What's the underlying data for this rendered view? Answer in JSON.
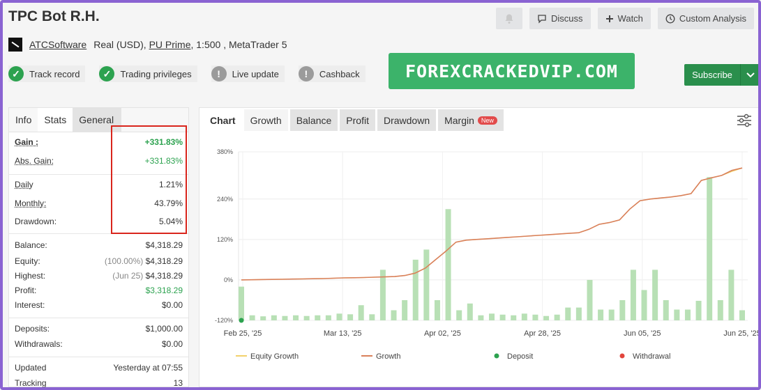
{
  "header": {
    "title": "TPC Bot R.H.",
    "buttons": {
      "discuss": "Discuss",
      "watch": "Watch",
      "custom_analysis": "Custom Analysis"
    }
  },
  "account": {
    "owner": "ATCSoftware",
    "type": "Real (USD),",
    "broker": "PU Prime",
    "leverage_platform": ", 1:500 , MetaTrader 5"
  },
  "badges": [
    {
      "label": "Track record",
      "status": "ok"
    },
    {
      "label": "Trading privileges",
      "status": "ok"
    },
    {
      "label": "Live update",
      "status": "warn"
    },
    {
      "label": "Cashback",
      "status": "warn"
    }
  ],
  "promo": "FOREXCRACKEDVIP.COM",
  "subscribe": "Subscribe",
  "left_tabs": [
    "Info",
    "Stats",
    "General"
  ],
  "stats": {
    "gain": {
      "k": "Gain :",
      "v": "+331.83%"
    },
    "abs_gain": {
      "k": "Abs. Gain:",
      "v": "+331.83%"
    },
    "daily": {
      "k": "Daily",
      "v": "1.21%"
    },
    "monthly": {
      "k": "Monthly:",
      "v": "43.79%"
    },
    "drawdown": {
      "k": "Drawdown:",
      "v": "5.04%"
    },
    "balance": {
      "k": "Balance:",
      "v": "$4,318.29"
    },
    "equity": {
      "k": "Equity:",
      "pre": "(100.00%)",
      "v": "$4,318.29"
    },
    "highest": {
      "k": "Highest:",
      "pre": "(Jun 25)",
      "v": "$4,318.29"
    },
    "profit": {
      "k": "Profit:",
      "v": "$3,318.29"
    },
    "interest": {
      "k": "Interest:",
      "v": "$0.00"
    },
    "deposits": {
      "k": "Deposits:",
      "v": "$1,000.00"
    },
    "withdrawals": {
      "k": "Withdrawals:",
      "v": "$0.00"
    },
    "updated": {
      "k": "Updated",
      "v": "Yesterday at 07:55"
    },
    "tracking": {
      "k": "Tracking",
      "v": "13"
    }
  },
  "right_tabs": {
    "chart": "Chart",
    "growth": "Growth",
    "balance": "Balance",
    "profit": "Profit",
    "drawdown": "Drawdown",
    "margin": "Margin",
    "new": "New"
  },
  "colors": {
    "green": "#2ca24f",
    "growth_line": "#d9805a",
    "equity_line": "#f2d16b",
    "bar": "#b8e0b5",
    "deposit": "#2ca24f",
    "withdrawal": "#e2453c"
  },
  "chart_data": {
    "type": "bar",
    "x_ticks": [
      "Feb 25, '25",
      "Mar 13, '25",
      "Apr 02, '25",
      "Apr 28, '25",
      "Jun 05, '25",
      "Jun 25, '25"
    ],
    "y_ticks": [
      "380%",
      "240%",
      "120%",
      "0%",
      "-120%"
    ],
    "ylim": [
      -120,
      380
    ],
    "legend": [
      "Equity Growth",
      "Growth",
      "Deposit",
      "Withdrawal"
    ],
    "bars": [
      -20,
      -105,
      -108,
      -105,
      -107,
      -105,
      -107,
      -105,
      -105,
      -100,
      -102,
      -75,
      -102,
      30,
      -90,
      -60,
      60,
      90,
      -60,
      210,
      -90,
      -70,
      -105,
      -100,
      -103,
      -105,
      -100,
      -103,
      -107,
      -103,
      -82,
      -82,
      0,
      -88,
      -88,
      -60,
      30,
      -30,
      30,
      -60,
      -88,
      -88,
      -62,
      305,
      -60,
      30,
      -90
    ],
    "growth_line": [
      0,
      0.5,
      1,
      1.5,
      2,
      2.5,
      3,
      3.5,
      4,
      5,
      6,
      6.5,
      7,
      8,
      9,
      10,
      13,
      20,
      35,
      60,
      85,
      112,
      118,
      120,
      122,
      124,
      126,
      128,
      130,
      132,
      134,
      136,
      138,
      140,
      150,
      165,
      170,
      178,
      210,
      235,
      240,
      243,
      246,
      250,
      256,
      295,
      303,
      310,
      325,
      332
    ],
    "equity_line": [
      0,
      0.5,
      1,
      1.5,
      2,
      2.5,
      3,
      3.5,
      4,
      5,
      6,
      6.5,
      7,
      8,
      9,
      10,
      13,
      20,
      35,
      60,
      85,
      112,
      118,
      120,
      122,
      124,
      126,
      128,
      130,
      132,
      134,
      136,
      138,
      140,
      150,
      165,
      170,
      178,
      210,
      235,
      240,
      243,
      246,
      250,
      256,
      295,
      303,
      310,
      322,
      332
    ],
    "deposits": [
      {
        "x_index": 0,
        "value": -120
      }
    ]
  }
}
